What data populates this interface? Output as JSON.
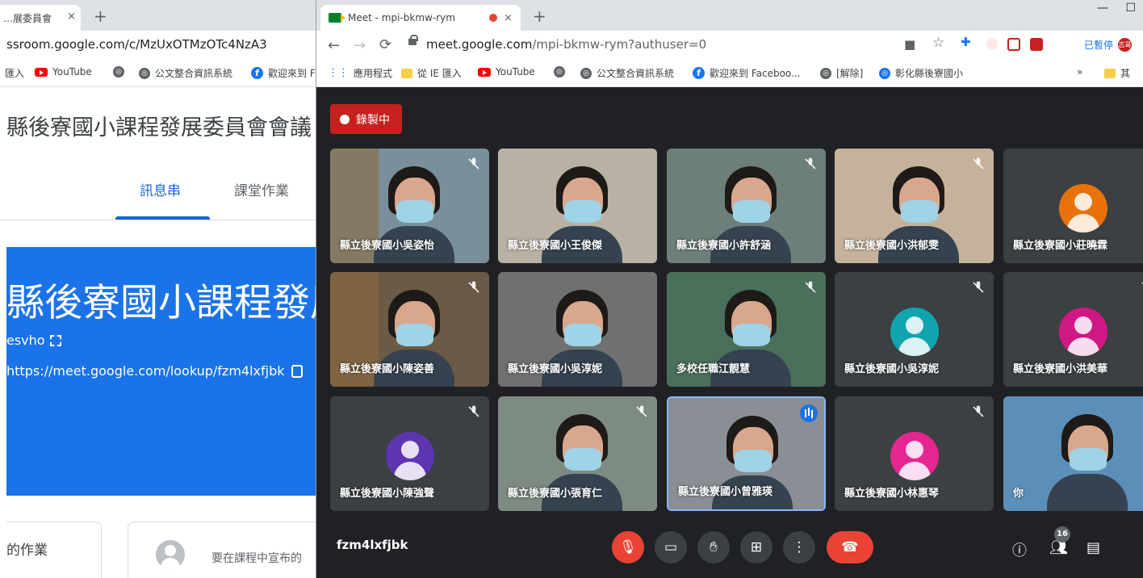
{
  "back_window": {
    "tab_title": "…展委員會 ",
    "tab_close": "×",
    "new_tab": "+",
    "url": "ssroom.google.com/c/MzUxOTMzOTc4NzA3",
    "bookmarks": [
      "匯入",
      "YouTube",
      "",
      "公文整合資訊系統",
      "歡迎來到 F"
    ],
    "class_title": "縣後寮國小課程發展委員會會議",
    "tabs": [
      "訊息串",
      "課堂作業"
    ],
    "banner_title": "縣後寮國小課程發展",
    "class_code": "esvho",
    "meet_link": "https://meet.google.com/lookup/fzm4lxfjbk",
    "upcoming_label": "的作業",
    "announce_placeholder": "要在課程中宣布的"
  },
  "front_window": {
    "tab_title": "Meet - mpi-bkmw-rym",
    "tab_close": "×",
    "new_tab": "+",
    "window_controls": [
      "—",
      "☐"
    ],
    "url_host": "meet.google.com",
    "url_path": "/mpi-bkmw-rym?authuser=0",
    "bookmarks": [
      "應用程式",
      "從 IE 匯入",
      "YouTube",
      "",
      "公文整合資訊系統",
      "歡迎來到 Faceboo...",
      "[解除]",
      "彰化縣後寮國小",
      "»",
      "其"
    ],
    "paused_label": "已暫停",
    "profile_initial": "志哥"
  },
  "meet": {
    "recording_label": "錄製中",
    "meeting_code": "fzm4lxfjbk",
    "participant_count": "16",
    "participants": [
      {
        "name": "縣立後寮國小吳姿怡",
        "kind": "video",
        "muted": true
      },
      {
        "name": "縣立後寮國小王俊傑",
        "kind": "video",
        "muted": false
      },
      {
        "name": "縣立後寮國小許舒涵",
        "kind": "video",
        "muted": true
      },
      {
        "name": "縣立後寮國小洪郁雯",
        "kind": "video",
        "muted": true
      },
      {
        "name": "縣立後寮國小莊曉霖",
        "kind": "avatar",
        "color": "#e8710a",
        "muted": false
      },
      {
        "name": "縣立後寮國小陳姿善",
        "kind": "video",
        "muted": true
      },
      {
        "name": "縣立後寮國小吳淳妮",
        "kind": "video",
        "muted": false
      },
      {
        "name": "多校任職江靚慧",
        "kind": "video",
        "muted": true
      },
      {
        "name": "縣立後寮國小吳淳妮",
        "kind": "avatar",
        "color": "#12a4af",
        "muted": true
      },
      {
        "name": "縣立後寮國小洪美華",
        "kind": "avatar",
        "color": "#d01884",
        "muted": true
      },
      {
        "name": "縣立後寮國小陳強聲",
        "kind": "avatar",
        "color": "#5e35b1",
        "muted": true
      },
      {
        "name": "縣立後寮國小張育仁",
        "kind": "video",
        "muted": true
      },
      {
        "name": "縣立後寮國小曾雅瑛",
        "kind": "video",
        "muted": false,
        "speaking": true
      },
      {
        "name": "縣立後寮國小林惠琴",
        "kind": "avatar",
        "color": "#e52592",
        "muted": true
      },
      {
        "name": "你",
        "kind": "video",
        "muted": false
      }
    ],
    "controls": [
      "mic-off",
      "camera",
      "raise-hand",
      "present",
      "more",
      "leave-call"
    ],
    "right_controls": [
      "info",
      "people",
      "chat"
    ]
  }
}
